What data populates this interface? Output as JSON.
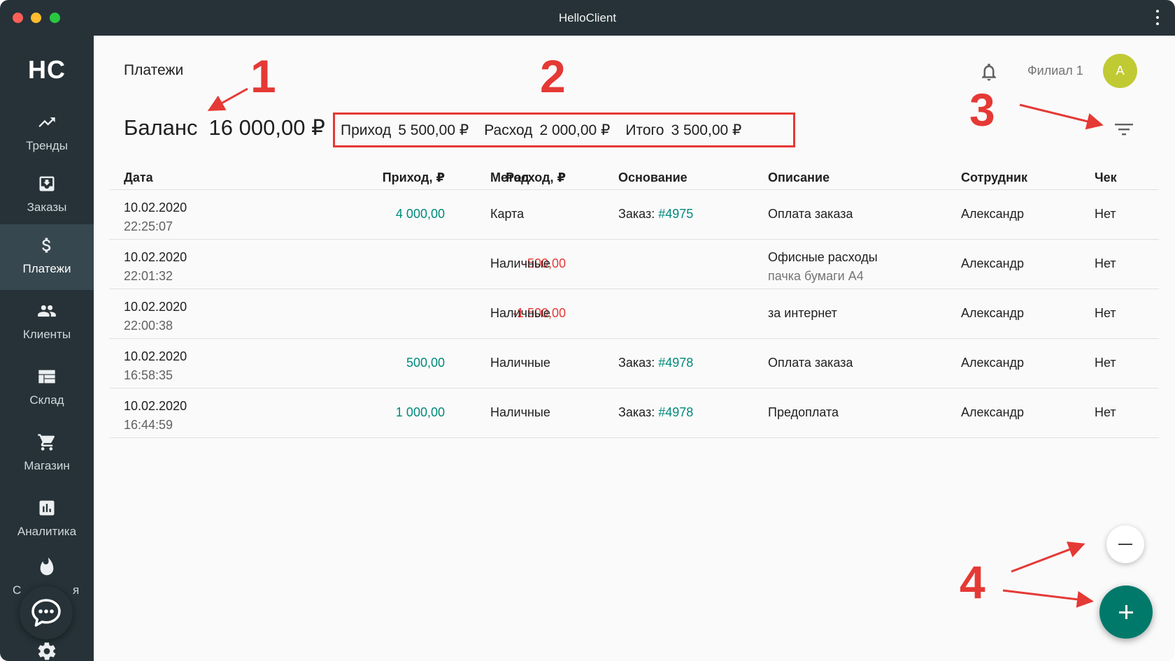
{
  "window": {
    "title": "HelloClient"
  },
  "sidebar": {
    "logo": "HC",
    "items": [
      {
        "label": "Тренды",
        "icon": "trending-up-icon"
      },
      {
        "label": "Заказы",
        "icon": "inbox-download-icon"
      },
      {
        "label": "Платежи",
        "icon": "dollar-icon",
        "active": true
      },
      {
        "label": "Клиенты",
        "icon": "people-icon"
      },
      {
        "label": "Склад",
        "icon": "warehouse-icon"
      },
      {
        "label": "Магазин",
        "icon": "cart-icon"
      },
      {
        "label": "Аналитика",
        "icon": "bar-chart-icon"
      },
      {
        "label_left": "С",
        "label_right": "я",
        "icon": "fire-icon"
      }
    ],
    "chat_icon": "chat-bubble-icon",
    "settings_icon": "gear-icon"
  },
  "header": {
    "page_title": "Платежи",
    "branch": "Филиал 1",
    "avatar_initial": "А"
  },
  "balance": {
    "label": "Баланс",
    "value": "16 000,00 ₽"
  },
  "summary": {
    "income_label": "Приход",
    "income_value": "5 500,00 ₽",
    "expense_label": "Расход",
    "expense_value": "2 000,00 ₽",
    "total_label": "Итого",
    "total_value": "3 500,00 ₽"
  },
  "table": {
    "columns": [
      "Дата",
      "Приход, ₽",
      "Расход, ₽",
      "Метод",
      "Основание",
      "Описание",
      "Сотрудник",
      "Чек"
    ],
    "rows": [
      {
        "date": "10.02.2020",
        "time": "22:25:07",
        "income": "4 000,00",
        "expense": "",
        "method": "Карта",
        "basis_label": "Заказ:",
        "basis_link": "#4975",
        "description": "Оплата заказа",
        "description_sub": "",
        "staff": "Александр",
        "check": "Нет"
      },
      {
        "date": "10.02.2020",
        "time": "22:01:32",
        "income": "",
        "expense": "-500,00",
        "method": "Наличные",
        "basis_label": "",
        "basis_link": "",
        "description": "Офисные расходы",
        "description_sub": "пачка бумаги А4",
        "staff": "Александр",
        "check": "Нет"
      },
      {
        "date": "10.02.2020",
        "time": "22:00:38",
        "income": "",
        "expense": "-1 500,00",
        "method": "Наличные",
        "basis_label": "",
        "basis_link": "",
        "description": "за интернет",
        "description_sub": "",
        "staff": "Александр",
        "check": "Нет"
      },
      {
        "date": "10.02.2020",
        "time": "16:58:35",
        "income": "500,00",
        "expense": "",
        "method": "Наличные",
        "basis_label": "Заказ:",
        "basis_link": "#4978",
        "description": "Оплата заказа",
        "description_sub": "",
        "staff": "Александр",
        "check": "Нет"
      },
      {
        "date": "10.02.2020",
        "time": "16:44:59",
        "income": "1 000,00",
        "expense": "",
        "method": "Наличные",
        "basis_label": "Заказ:",
        "basis_link": "#4978",
        "description": "Предоплата",
        "description_sub": "",
        "staff": "Александр",
        "check": "Нет"
      }
    ]
  },
  "annotations": [
    "1",
    "2",
    "3",
    "4"
  ],
  "colors": {
    "sidebar_bg": "#263238",
    "sidebar_active": "#37474f",
    "income": "#00897b",
    "expense": "#e53935",
    "fab_primary": "#00796b",
    "avatar": "#c0ca33",
    "annotation": "#e53935"
  }
}
